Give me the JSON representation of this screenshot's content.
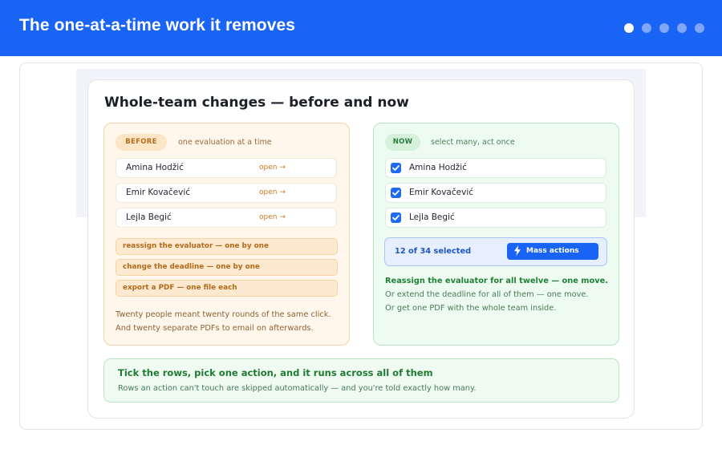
{
  "header": {
    "title": "The one-at-a-time work it removes",
    "dots": [
      true,
      false,
      false,
      false,
      false
    ],
    "accent_color": "#1a64f5"
  },
  "card": {
    "title": "Whole-team changes — before and now"
  },
  "before": {
    "badge": "BEFORE",
    "tagline": "one evaluation at a time",
    "rows": [
      {
        "name": "Amina Hodžić",
        "action": "open →"
      },
      {
        "name": "Emir Kovačević",
        "action": "open →"
      },
      {
        "name": "Lejla Begić",
        "action": "open →"
      }
    ],
    "actions": [
      "reassign the evaluator — one by one",
      "change the deadline — one by one",
      "export a PDF — one file each"
    ],
    "notes": [
      "Twenty people meant twenty rounds of the same click.",
      "And twenty separate PDFs to email on afterwards."
    ]
  },
  "now": {
    "badge": "NOW",
    "tagline": "select many, act once",
    "rows": [
      {
        "name": "Amina Hodžić",
        "checked": true
      },
      {
        "name": "Emir Kovačević",
        "checked": true
      },
      {
        "name": "Lejla Begić",
        "checked": true
      }
    ],
    "selection": {
      "count_label": "12 of 34 selected",
      "button_label": "Mass actions",
      "button_icon": "bolt-icon"
    },
    "notes": [
      "Reassign the evaluator for all twelve — one move.",
      "Or extend the deadline for all of them — one move.",
      "Or get one PDF with the whole team inside."
    ]
  },
  "footer": {
    "title": "Tick the rows, pick one action, and it runs across all of them",
    "text": "Rows an action can't touch are skipped automatically — and you're told exactly how many."
  }
}
